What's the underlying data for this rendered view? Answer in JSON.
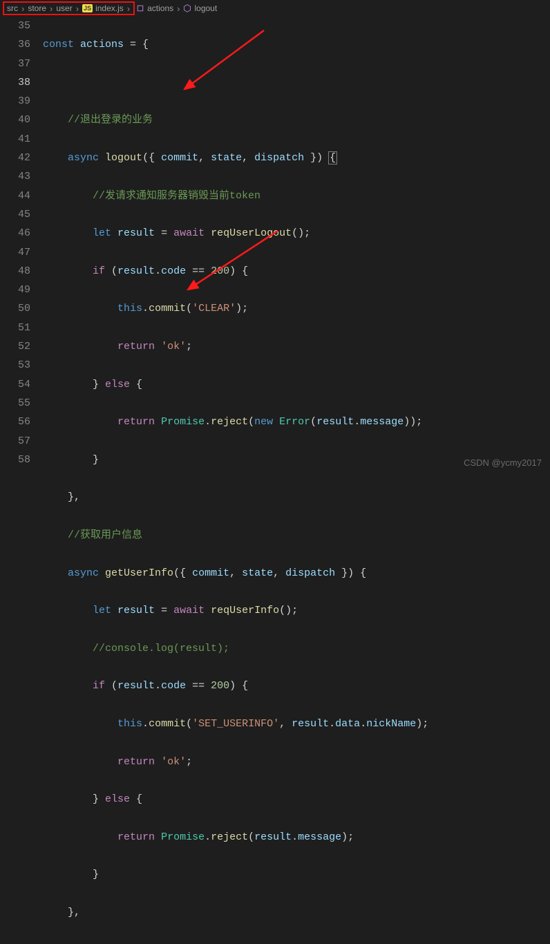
{
  "breadcrumb": {
    "parts": [
      "src",
      "store",
      "user",
      "index.js",
      "actions",
      "logout"
    ],
    "js_label": "JS"
  },
  "gutter": {
    "start": 35,
    "end": 58,
    "current": 38
  },
  "code": {
    "l35": {
      "kw": "const",
      "var": "actions",
      "eq": " = {"
    },
    "l37": "//退出登录的业务",
    "l38": {
      "async": "async",
      "fn": "logout",
      "args_open": "({ ",
      "a1": "commit",
      "c": ", ",
      "a2": "state",
      "a3": "dispatch",
      "args_close": " }) ",
      "brace": "{"
    },
    "l39": "//发请求通知服务器销毁当前token",
    "l40": {
      "let": "let",
      "v": "result",
      "eq": " = ",
      "await": "await",
      "fn": "reqUserLogout",
      "tail": "();"
    },
    "l41": {
      "if": "if",
      "open": " (",
      "v": "result",
      "dot": ".",
      "p": "code",
      "op": " == ",
      "n": "200",
      "close": ") {"
    },
    "l42": {
      "this": "this",
      "dot": ".",
      "fn": "commit",
      "open": "(",
      "s": "'CLEAR'",
      "close": ");"
    },
    "l43": {
      "ret": "return",
      "sp": " ",
      "s": "'ok'",
      "semi": ";"
    },
    "l44": {
      "close": "} ",
      "else": "else",
      "open": " {"
    },
    "l45": {
      "ret": "return",
      "sp": " ",
      "t": "Promise",
      "dot": ".",
      "fn": "reject",
      "open": "(",
      "new": "new",
      "sp2": " ",
      "t2": "Error",
      "open2": "(",
      "v": "result",
      "dot2": ".",
      "p": "message",
      "close": "));"
    },
    "l46": "}",
    "l47": "},",
    "l48": "//获取用户信息",
    "l49": {
      "async": "async",
      "fn": "getUserInfo",
      "args_open": "({ ",
      "a1": "commit",
      "c": ", ",
      "a2": "state",
      "a3": "dispatch",
      "args_close": " }) {"
    },
    "l50": {
      "let": "let",
      "v": "result",
      "eq": " = ",
      "await": "await",
      "fn": "reqUserInfo",
      "tail": "();"
    },
    "l51": "//console.log(result);",
    "l52": {
      "if": "if",
      "open": " (",
      "v": "result",
      "dot": ".",
      "p": "code",
      "op": " == ",
      "n": "200",
      "close": ") {"
    },
    "l53": {
      "this": "this",
      "dot": ".",
      "fn": "commit",
      "open": "(",
      "s": "'SET_USERINFO'",
      "c": ", ",
      "v": "result",
      "dot2": ".",
      "p": "data",
      "dot3": ".",
      "p2": "nickName",
      "close": ");"
    },
    "l54": {
      "ret": "return",
      "sp": " ",
      "s": "'ok'",
      "semi": ";"
    },
    "l55": {
      "close": "} ",
      "else": "else",
      "open": " {"
    },
    "l56": {
      "ret": "return",
      "sp": " ",
      "t": "Promise",
      "dot": ".",
      "fn": "reject",
      "open": "(",
      "v": "result",
      "dot2": ".",
      "p": "message",
      "close": ");"
    },
    "l57": "}",
    "l58": "},"
  },
  "watermark": "CSDN @ycmy2017"
}
